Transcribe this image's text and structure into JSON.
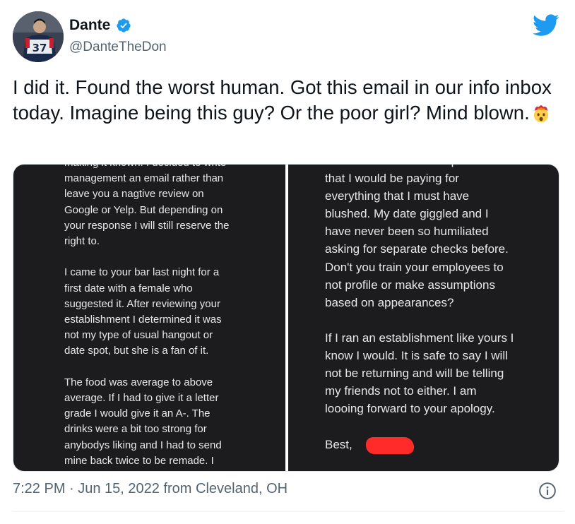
{
  "author": {
    "display_name": "Dante",
    "handle": "@DanteTheDon",
    "verified": true,
    "avatar_icon": "avatar-jersey-37"
  },
  "brand": {
    "logo_icon": "twitter-bird-icon",
    "color": "#1d9bf0"
  },
  "tweet": {
    "text": "I did it. Found the worst human. Got this email in our info inbox today. Imagine being this guy? Or the poor girl? Mind blown.",
    "emoji_icon": "exploding-head-emoji"
  },
  "media": {
    "left_text": "making it known. I decided to write\nmanagement an email rather than\nleave you a nagtive review on\nGoogle or Yelp. But depending on\nyour response I will still reserve the\nright to.\n\nI came to your bar last night for a\nfirst date with a female who\nsuggested it. After reviewing your\nestablishment I determined it was\nnot my type of usual hangout or\ndate spot, but she is a fan of it.\n\nThe food was average to above\naverage. If I had to give it a letter\ngrade I would give it an A-. The\ndrinks were a bit too strong for\nanybodys liking and I had to send\nmine back twice to be remade. I\nordered a rum and coke.",
    "right_text": "because we were a couple and\nthat I would be paying for\neverything that I must have\nblushed. My date giggled and I\nhave never been so humiliated\nasking for separate checks before.\nDon't you train your employees to\nnot profile or make assumptions\nbased on appearances?\n\nIf I ran an establishment like yours I\nknow I would. It is safe to say I will\nnot be returning and will be telling\nmy friends not to either. I am\nloooing forward to your apology.\n\nBest,",
    "redaction_color": "#ff2a2a"
  },
  "meta": {
    "timestamp": "7:22 PM · Jun 15, 2022 from Cleveland, OH",
    "info_icon": "info-icon"
  }
}
